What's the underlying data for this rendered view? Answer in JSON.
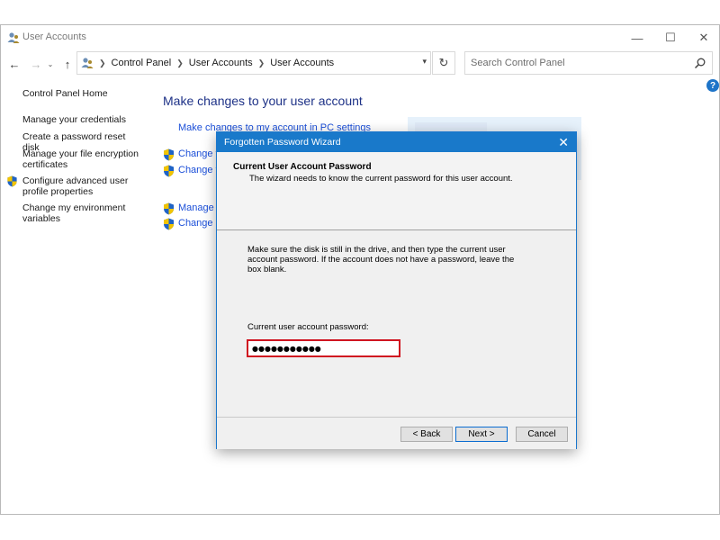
{
  "window": {
    "title": "User Accounts",
    "controls": {
      "minimize": "—",
      "maximize": "☐",
      "close": "✕"
    }
  },
  "navigation": {
    "back": "←",
    "forward": "→",
    "recent": "⌄",
    "up": "↑",
    "breadcrumbs": [
      "Control Panel",
      "User Accounts",
      "User Accounts"
    ],
    "refresh": "↻"
  },
  "search": {
    "placeholder": "Search Control Panel"
  },
  "help": "?",
  "sidebar": {
    "items": [
      {
        "label": "Control Panel Home",
        "shield": false
      },
      {
        "label": "Manage your credentials",
        "shield": false
      },
      {
        "label": "Create a password reset disk",
        "shield": false
      },
      {
        "label": "Manage your file encryption certificates",
        "shield": false
      },
      {
        "label": "Configure advanced user profile properties",
        "shield": true
      },
      {
        "label": "Change my environment variables",
        "shield": false
      }
    ]
  },
  "main": {
    "heading": "Make changes to your user account",
    "pc_settings_link": "Make changes to my account in PC settings",
    "links": [
      "Change yo",
      "Change yo",
      "Manage a",
      "Change U"
    ]
  },
  "dialog": {
    "title": "Forgotten Password Wizard",
    "close": "✕",
    "header_title": "Current User Account Password",
    "header_subtitle": "The wizard needs to know the current password for this user account.",
    "instructions": "Make sure the disk is still in the drive, and then type the current user account password. If the account does not have a password, leave the box blank.",
    "password_label": "Current user account password:",
    "password_value": "●●●●●●●●●●●",
    "buttons": {
      "back": "< Back",
      "next": "Next >",
      "cancel": "Cancel"
    }
  },
  "colors": {
    "accent": "#1979ca",
    "heading": "#1e3287",
    "link": "#1a4ed8",
    "highlight_border": "#d01520"
  }
}
